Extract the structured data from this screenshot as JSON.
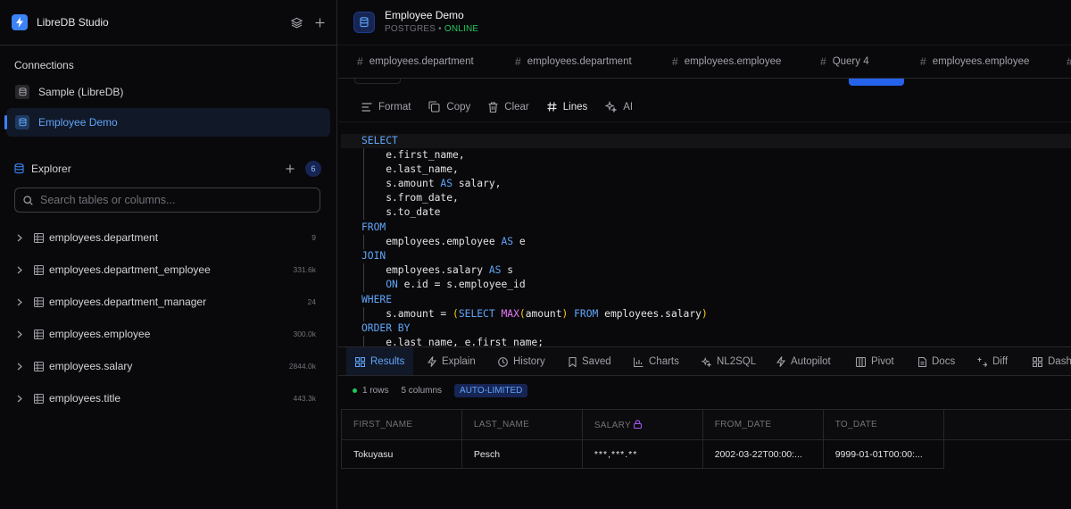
{
  "app": {
    "name": "LibreDB Studio"
  },
  "sidebar": {
    "connections_title": "Connections",
    "connections": [
      {
        "label": "Sample (LibreDB)",
        "active": false
      },
      {
        "label": "Employee Demo",
        "active": true
      }
    ],
    "explorer": {
      "title": "Explorer",
      "count": "6",
      "search_placeholder": "Search tables or columns...",
      "tables": [
        {
          "name": "employees.department",
          "count": "9"
        },
        {
          "name": "employees.department_employee",
          "count": "331.6k"
        },
        {
          "name": "employees.department_manager",
          "count": "24"
        },
        {
          "name": "employees.employee",
          "count": "300.0k"
        },
        {
          "name": "employees.salary",
          "count": "2844.0k"
        },
        {
          "name": "employees.title",
          "count": "443.3k"
        }
      ]
    }
  },
  "main": {
    "db_name": "Employee Demo",
    "db_type": "POSTGRES",
    "db_separator": "•",
    "db_status": "ONLINE",
    "query_tabs": [
      "employees.department",
      "employees.department",
      "employees.employee",
      "Query 4",
      "employees.employee"
    ],
    "toolbar": {
      "format": "Format",
      "copy": "Copy",
      "clear": "Clear",
      "lines": "Lines",
      "ai": "AI"
    },
    "result_tabs": [
      "Results",
      "Explain",
      "History",
      "Saved",
      "Charts",
      "NL2SQL",
      "Autopilot",
      "Pivot",
      "Docs",
      "Diff",
      "Dash"
    ],
    "result_meta": {
      "rows": "1 rows",
      "columns": "5 columns",
      "badge": "AUTO-LIMITED"
    },
    "grid": {
      "headers": [
        "FIRST_NAME",
        "LAST_NAME",
        "SALARY",
        "FROM_DATE",
        "TO_DATE"
      ],
      "rows": [
        [
          "Tokuyasu",
          "Pesch",
          "***,***.**",
          "2002-03-22T00:00:...",
          "9999-01-01T00:00:..."
        ]
      ]
    }
  },
  "colors": {
    "accent": "#3b82f6",
    "online": "#22c55e",
    "keyword": "#60a5fa",
    "function": "#e879f9"
  }
}
